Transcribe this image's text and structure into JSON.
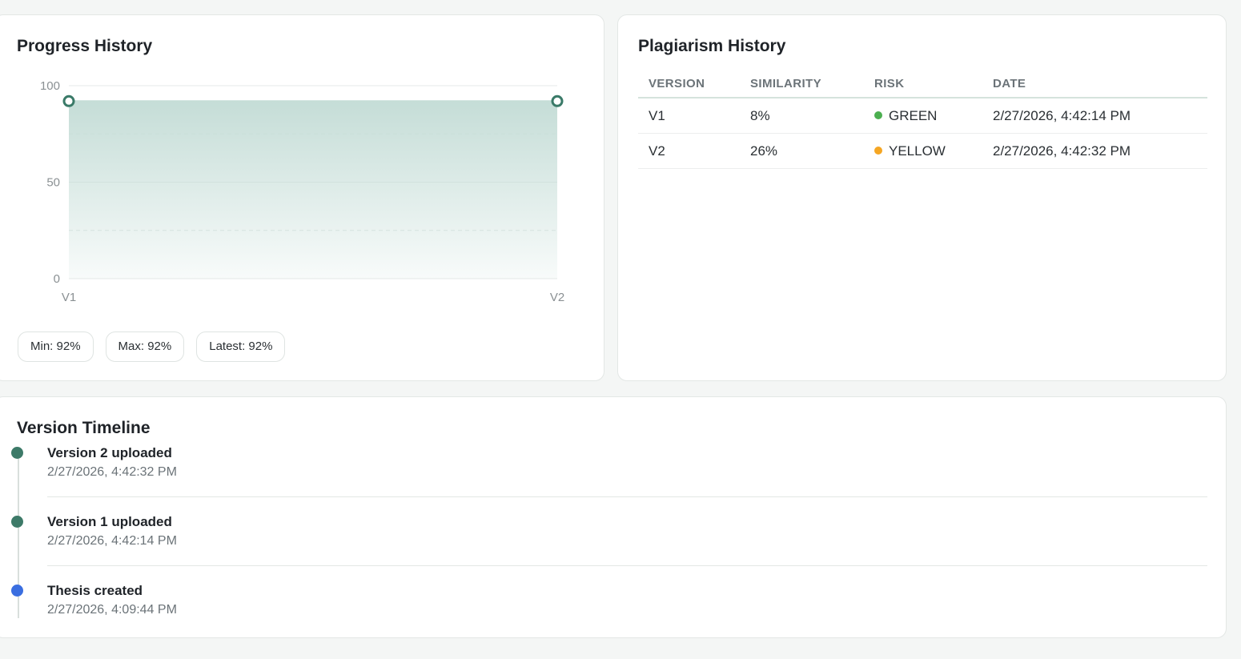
{
  "progress": {
    "title": "Progress History",
    "stats": {
      "min_label": "Min: 92%",
      "max_label": "Max: 92%",
      "latest_label": "Latest: 92%"
    },
    "colors": {
      "line": "#3a7a68",
      "fill": "#c5ddd7"
    }
  },
  "chart_data": {
    "type": "area",
    "title": "",
    "xlabel": "",
    "ylabel": "",
    "categories": [
      "V1",
      "V2"
    ],
    "values": [
      92,
      92
    ],
    "ylim": [
      0,
      100
    ],
    "yticks": [
      0,
      50,
      100
    ],
    "grid": true,
    "legend": "none"
  },
  "plagiarism": {
    "title": "Plagiarism History",
    "columns": [
      "VERSION",
      "SIMILARITY",
      "RISK",
      "DATE"
    ],
    "rows": [
      {
        "version": "V1",
        "similarity": "8%",
        "risk": "GREEN",
        "risk_color": "#4caf50",
        "date": "2/27/2026, 4:42:14 PM"
      },
      {
        "version": "V2",
        "similarity": "26%",
        "risk": "YELLOW",
        "risk_color": "#f5a623",
        "date": "2/27/2026, 4:42:32 PM"
      }
    ]
  },
  "timeline": {
    "title": "Version Timeline",
    "items": [
      {
        "title": "Version 2 uploaded",
        "date": "2/27/2026, 4:42:32 PM",
        "dot_color": "#3d7a68"
      },
      {
        "title": "Version 1 uploaded",
        "date": "2/27/2026, 4:42:14 PM",
        "dot_color": "#3d7a68"
      },
      {
        "title": "Thesis created",
        "date": "2/27/2026, 4:09:44 PM",
        "dot_color": "#3a6ee0"
      }
    ]
  }
}
